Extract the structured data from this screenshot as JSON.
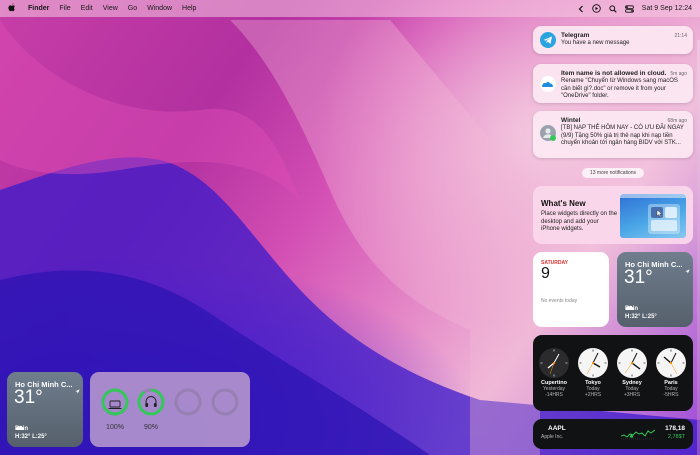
{
  "menubar": {
    "app_name": "Finder",
    "menus": [
      "File",
      "Edit",
      "View",
      "Go",
      "Window",
      "Help"
    ],
    "datetime": "Sat 9 Sep  12:24"
  },
  "notifications": [
    {
      "app": "Telegram",
      "time": "21:14",
      "body": "You have a new message",
      "icon": "telegram-icon",
      "color": "#2aa3df"
    },
    {
      "app": "Item name is not allowed in cloud.",
      "time": "5m ago",
      "body": "Rename \"Chuyển từ Windows sang macOS cần biết gì?.doc\" or remove it from your \"OneDrive\" folder.",
      "icon": "onedrive-icon",
      "color": "#1e8de0"
    },
    {
      "app": "Wintel",
      "time": "68m ago",
      "body": "[TB] NẠP THẺ HÔM NAY - CÓ ƯU ĐÃI NGAY (9/9) Tặng 50% giá trị thẻ nạp khi nạp tiền chuyển khoản tới ngân hàng BIDV với STK...",
      "icon": "contact-avatar-icon",
      "color": "#9aa3ad"
    }
  ],
  "more_notifications": "13 more notifications",
  "whats_new": {
    "title": "What's New",
    "text": "Place widgets directly on the desktop and add your iPhone widgets."
  },
  "calendar": {
    "weekday": "SATURDAY",
    "day": "9",
    "events": "No events today"
  },
  "weather": {
    "city": "Ho Chi Minh C...",
    "temp": "31°",
    "condition": "Rain",
    "highlow": "H:32° L:25°"
  },
  "world_clock": [
    {
      "city": "Cupertino",
      "day": "Yesterday",
      "offset": "-14HRS"
    },
    {
      "city": "Tokyo",
      "day": "Today",
      "offset": "+2HRS"
    },
    {
      "city": "Sydney",
      "day": "Today",
      "offset": "+3HRS"
    },
    {
      "city": "Paris",
      "day": "Today",
      "offset": "-5HRS"
    }
  ],
  "stock": {
    "symbol": "AAPL",
    "company": "Apple Inc.",
    "price": "178,18",
    "change": "2,78$T"
  },
  "batteries": [
    {
      "device": "laptop-icon",
      "percent": "100%",
      "level": 1.0
    },
    {
      "device": "headphones-icon",
      "percent": "90%",
      "level": 0.9
    },
    {
      "device": "empty-slot",
      "percent": "",
      "level": 0
    },
    {
      "device": "empty-slot",
      "percent": "",
      "level": 0
    }
  ]
}
